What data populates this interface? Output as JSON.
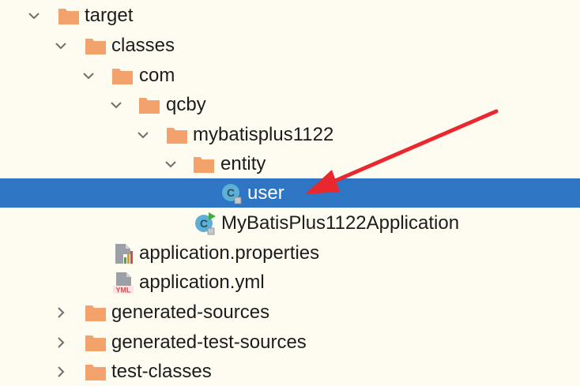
{
  "project_tree": {
    "items": [
      {
        "label": "target",
        "type": "folder",
        "state": "expanded"
      },
      {
        "label": "classes",
        "type": "folder",
        "state": "expanded"
      },
      {
        "label": "com",
        "type": "folder",
        "state": "expanded"
      },
      {
        "label": "qcby",
        "type": "folder",
        "state": "expanded"
      },
      {
        "label": "mybatisplus1122",
        "type": "folder",
        "state": "expanded"
      },
      {
        "label": "entity",
        "type": "folder",
        "state": "expanded"
      },
      {
        "label": "user",
        "type": "class-icon",
        "state": "selected"
      },
      {
        "label": "MyBatisPlus1122Application",
        "type": "runnable-class-icon",
        "state": "leaf"
      },
      {
        "label": "application.properties",
        "type": "properties-file-icon",
        "state": "leaf"
      },
      {
        "label": "application.yml",
        "type": "yml-file-icon",
        "state": "leaf"
      },
      {
        "label": "generated-sources",
        "type": "folder",
        "state": "collapsed"
      },
      {
        "label": "generated-test-sources",
        "type": "folder",
        "state": "collapsed"
      },
      {
        "label": "test-classes",
        "type": "folder",
        "state": "collapsed"
      }
    ],
    "icon_glyphs": {
      "class_letter": "C",
      "yml_badge": "YML"
    }
  },
  "annotation": {
    "type": "red-arrow",
    "points_to": "user"
  },
  "colors": {
    "background": "#fefcf1",
    "selection": "#2e75c4",
    "folder": "#f4a26b",
    "class_icon": "#5cb0d6",
    "run_badge": "#3fae3f",
    "arrow": "#e8282e",
    "yml_badge": "#d9474a",
    "text": "#1c1c1c",
    "chevron": "#6e6e6e"
  }
}
